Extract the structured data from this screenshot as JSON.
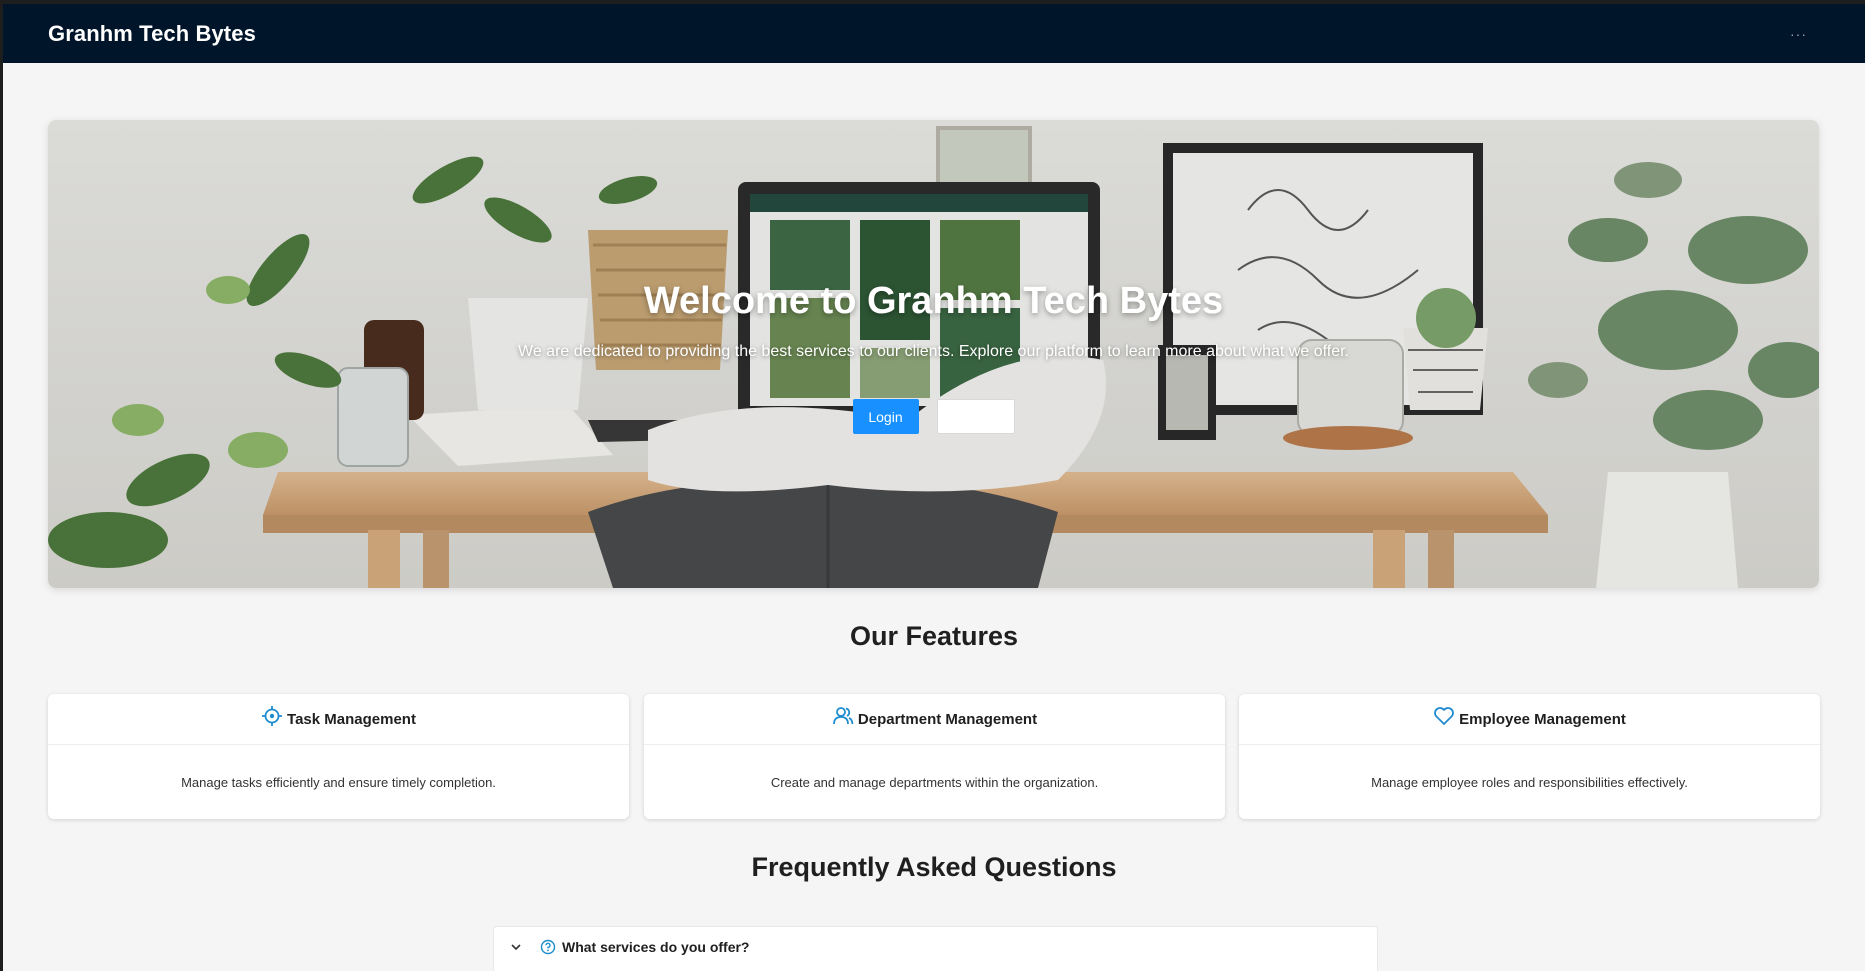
{
  "header": {
    "brand": "Granhm Tech Bytes",
    "menu_icon": "ellipsis-icon",
    "background_color": "#001529"
  },
  "hero": {
    "title": "Welcome to Granhm Tech Bytes",
    "subtitle": "We are dedicated to providing the best services to our clients. Explore our platform to learn more about what we offer.",
    "login_label": "Login",
    "secondary_label": "",
    "login_color": "#1890ff"
  },
  "features": {
    "title": "Our Features",
    "items": [
      {
        "icon": "aim-icon",
        "title": "Task Management",
        "description": "Manage tasks efficiently and ensure timely completion."
      },
      {
        "icon": "team-icon",
        "title": "Department Management",
        "description": "Create and manage departments within the organization."
      },
      {
        "icon": "heart-icon",
        "title": "Employee Management",
        "description": "Manage employee roles and responsibilities effectively."
      }
    ],
    "icon_color": "#1f8ccf"
  },
  "faq": {
    "title": "Frequently Asked Questions",
    "items": [
      {
        "icon": "question-circle-icon",
        "question": "What services do you offer?"
      }
    ]
  }
}
